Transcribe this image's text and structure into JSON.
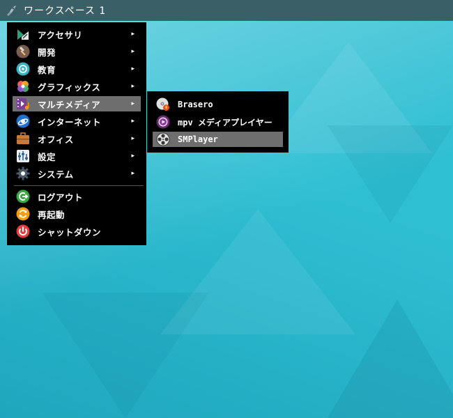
{
  "panel": {
    "workspace_label": "ワークスペース 1"
  },
  "menu": {
    "items": [
      {
        "label": "アクセサリ",
        "icon": "accessories-icon"
      },
      {
        "label": "開発",
        "icon": "hammer-icon"
      },
      {
        "label": "教育",
        "icon": "education-icon"
      },
      {
        "label": "グラフィックス",
        "icon": "graphics-icon"
      },
      {
        "label": "マルチメディア",
        "icon": "multimedia-icon"
      },
      {
        "label": "インターネット",
        "icon": "internet-icon"
      },
      {
        "label": "オフィス",
        "icon": "briefcase-icon"
      },
      {
        "label": "設定",
        "icon": "settings-icon"
      },
      {
        "label": "システム",
        "icon": "gear-icon"
      }
    ],
    "actions": [
      {
        "label": "ログアウト",
        "icon": "logout-icon"
      },
      {
        "label": "再起動",
        "icon": "reboot-icon"
      },
      {
        "label": "シャットダウン",
        "icon": "power-icon"
      }
    ],
    "submenu_arrow": "▸"
  },
  "submenu": {
    "items": [
      {
        "label": "Brasero",
        "icon": "brasero-icon"
      },
      {
        "label": "mpv メディアプレイヤー",
        "icon": "mpv-icon"
      },
      {
        "label": "SMPlayer",
        "icon": "smplayer-icon"
      }
    ]
  },
  "colors": {
    "panel": "#3b5f66",
    "menu_bg": "#000000",
    "highlight": "#6e6e6e",
    "desktop": "#2fbfd3"
  }
}
